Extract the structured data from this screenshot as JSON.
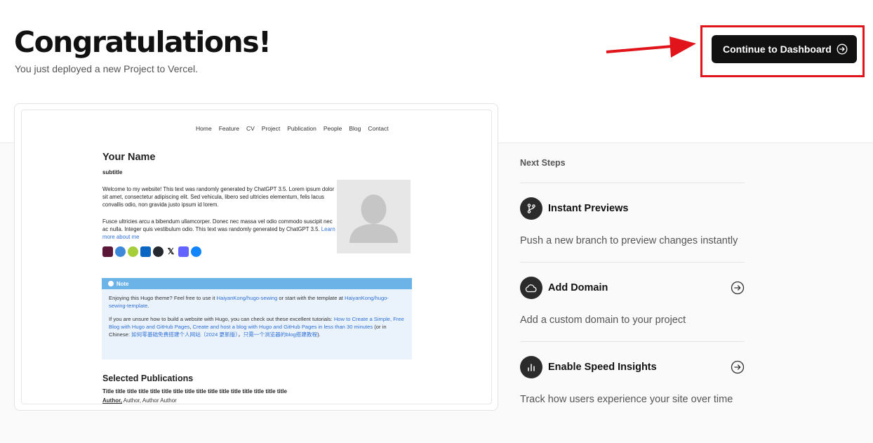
{
  "header": {
    "title": "Congratulations!",
    "subtitle": "You just deployed a new Project to Vercel.",
    "cta_label": "Continue to Dashboard"
  },
  "preview": {
    "nav": [
      "Home",
      "Feature",
      "CV",
      "Project",
      "Publication",
      "People",
      "Blog",
      "Contact"
    ],
    "name": "Your Name",
    "subtitle": "subtitle",
    "para1": "Welcome to my website! This text was randomly generated by ChatGPT 3.5. Lorem ipsum dolor sit amet, consectetur adipiscing elit. Sed vehicula, libero sed ultricies elementum, felis lacus convallis odio, non gravida justo ipsum id lorem.",
    "para2": "Fusce ultricies arcu a bibendum ullamcorper. Donec nec massa vel odio commodo suscipit nec ac nulla. Integer quis vestibulum odio. This text was randomly generated by ChatGPT 3.5.",
    "learn_more": "Learn more about me",
    "social_icons": [
      "email-icon",
      "academic-cap-icon",
      "orcid-icon",
      "linkedin-icon",
      "github-icon",
      "x-icon",
      "mastodon-icon",
      "bluesky-icon"
    ],
    "note": {
      "label": "Note",
      "p1_a": "Enjoying this Hugo theme? Feel free to use it ",
      "p1_link1": "HaiyanKong/hugo-sewing",
      "p1_b": " or start with the template at ",
      "p1_link2": "HaiyanKong/hugo-sewing-template",
      "p1_c": ".",
      "p2_a": "If you are unsure how to build a website with Hugo, you can check out these excellent tutorials: ",
      "p2_link1": "How to Create a Simple, Free Blog with Hugo and GitHub Pages",
      "p2_b": ", ",
      "p2_link2": "Create and host a blog with Hugo and GitHub Pages in less than 30 minutes",
      "p2_c": " (or in Chinese: ",
      "p2_link3": "如何零基础免费搭建个人网站（2024 更新版）",
      "p2_d": "，",
      "p2_link4": "只需一个浏览器的blog搭建教程",
      "p2_e": ")."
    },
    "publications_title": "Selected Publications",
    "pub_title": "Title title title title title title title title title title title title title title title title",
    "pub_author_main": "Author,",
    "pub_author_rest": " Author, Author Author"
  },
  "next_steps": {
    "heading": "Next Steps",
    "items": [
      {
        "title": "Instant Previews",
        "desc": "Push a new branch to preview changes instantly",
        "icon": "git-branch-icon"
      },
      {
        "title": "Add Domain",
        "desc": "Add a custom domain to your project",
        "icon": "cloud-icon"
      },
      {
        "title": "Enable Speed Insights",
        "desc": "Track how users experience your site over time",
        "icon": "bar-chart-icon"
      }
    ]
  },
  "colors": {
    "annotation_red": "#e0141a",
    "cta_bg": "#111111",
    "link_blue": "#2f6fd6",
    "note_header": "#6cb3e8"
  }
}
